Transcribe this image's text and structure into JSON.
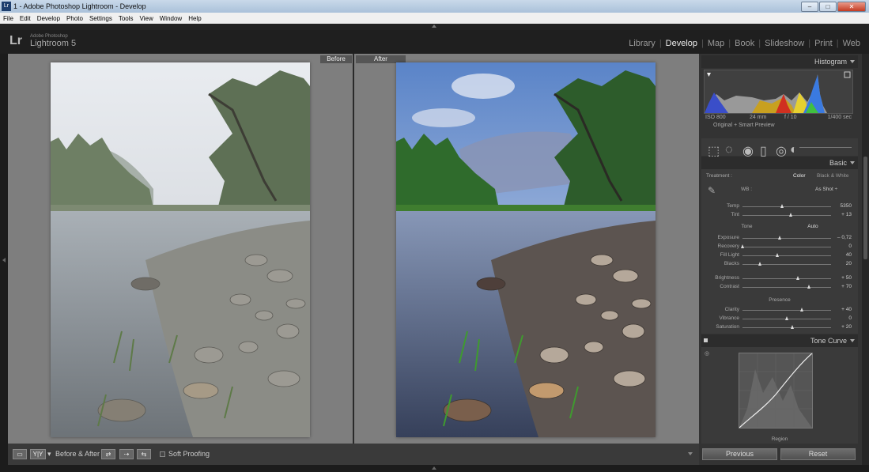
{
  "window": {
    "title": "1 - Adobe Photoshop Lightroom - Develop",
    "icon_label": "Lr",
    "minimize": "–",
    "maximize": "□",
    "close": "✕"
  },
  "menu": [
    "File",
    "Edit",
    "Develop",
    "Photo",
    "Settings",
    "Tools",
    "View",
    "Window",
    "Help"
  ],
  "identity": {
    "logo": "Lr",
    "brand": "Adobe Photoshop",
    "product": "Lightroom 5"
  },
  "modules": {
    "items": [
      "Library",
      "Develop",
      "Map",
      "Book",
      "Slideshow",
      "Print",
      "Web"
    ],
    "active": "Develop",
    "separator": "|"
  },
  "compare": {
    "before_label": "Before",
    "after_label": "After"
  },
  "toolbar": {
    "loupe_btn": "▭",
    "yy_btn": "Y|Y",
    "yy_arrow": "▾",
    "ba_label": "Before & After :",
    "btn_copy_left": "⇄",
    "btn_copy_right": "⇢",
    "btn_swap": "⇆",
    "soft_proofing": "Soft Proofing"
  },
  "histogram": {
    "title": "Histogram",
    "iso": "ISO 800",
    "focal": "24 mm",
    "aperture": "f / 10",
    "shutter": "1/400 sec",
    "preview": "Original + Smart Preview"
  },
  "basic": {
    "title": "Basic",
    "treatment_label": "Treatment :",
    "color": "Color",
    "bw": "Black & White",
    "wb_label": "WB :",
    "wb_value": "As Shot ÷",
    "tone_label": "Tone",
    "auto": "Auto",
    "presence_label": "Presence",
    "sliders": [
      {
        "label": "Temp",
        "value": "5350",
        "pos": 0.45
      },
      {
        "label": "Tint",
        "value": "+ 13",
        "pos": 0.55
      },
      {
        "label": "Exposure",
        "value": "– 0,72",
        "pos": 0.42
      },
      {
        "label": "Recovery",
        "value": "0",
        "pos": 0.0
      },
      {
        "label": "Fill Light",
        "value": "40",
        "pos": 0.4
      },
      {
        "label": "Blacks",
        "value": "20",
        "pos": 0.2
      },
      {
        "label": "Brightness",
        "value": "+ 50",
        "pos": 0.63
      },
      {
        "label": "Contrast",
        "value": "+ 70",
        "pos": 0.75
      },
      {
        "label": "Clarity",
        "value": "+ 40",
        "pos": 0.67
      },
      {
        "label": "Vibrance",
        "value": "0",
        "pos": 0.5
      },
      {
        "label": "Saturation",
        "value": "+ 20",
        "pos": 0.57
      }
    ]
  },
  "tone_curve": {
    "title": "Tone Curve",
    "region": "Region"
  },
  "panel_buttons": {
    "previous": "Previous",
    "reset": "Reset"
  },
  "colors": {
    "accent": "#ececec",
    "panel": "#3a3a3a",
    "canvas": "#7e7e7e"
  }
}
